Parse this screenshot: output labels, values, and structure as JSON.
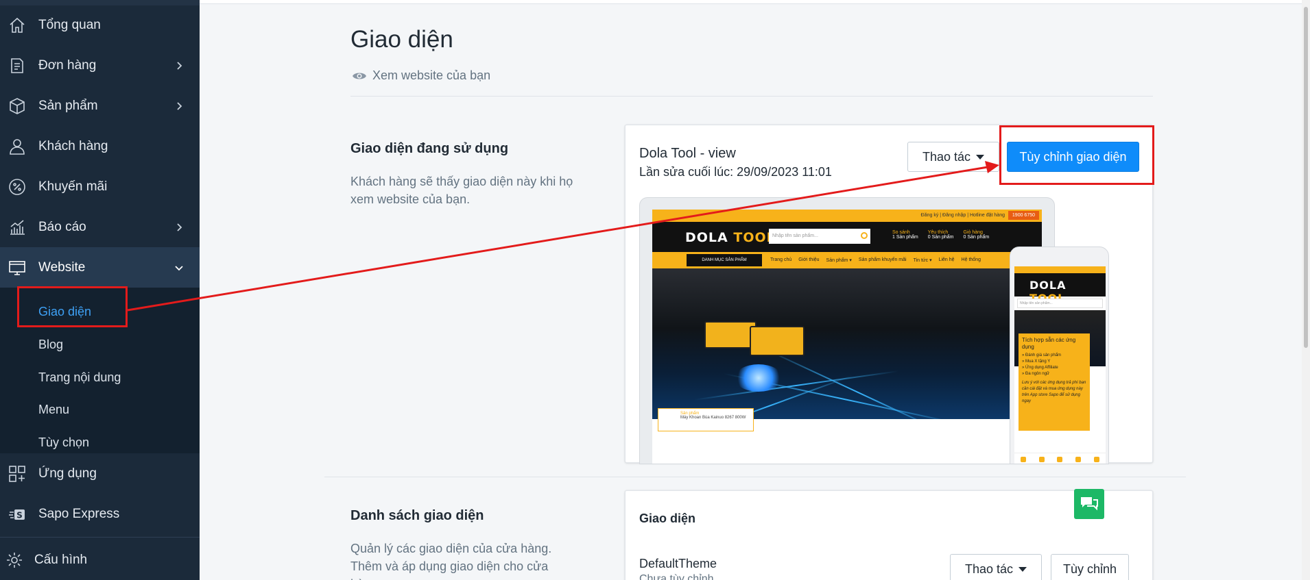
{
  "sidebar": {
    "items": [
      {
        "label": "Tổng quan",
        "icon": "home-icon",
        "chevron": false
      },
      {
        "label": "Đơn hàng",
        "icon": "order-icon",
        "chevron": true
      },
      {
        "label": "Sản phẩm",
        "icon": "box-icon",
        "chevron": true
      },
      {
        "label": "Khách hàng",
        "icon": "user-icon",
        "chevron": false
      },
      {
        "label": "Khuyến mãi",
        "icon": "discount-icon",
        "chevron": false
      },
      {
        "label": "Báo cáo",
        "icon": "report-icon",
        "chevron": true
      },
      {
        "label": "Website",
        "icon": "website-icon",
        "chevron": "down"
      },
      {
        "label": "Ứng dụng",
        "icon": "apps-icon",
        "chevron": false
      },
      {
        "label": "Sapo Express",
        "icon": "sapo-express-icon",
        "chevron": false
      },
      {
        "label": "Cấu hình",
        "icon": "gear-icon",
        "chevron": false
      }
    ],
    "website_sub": [
      "Giao diện",
      "Blog",
      "Trang nội dung",
      "Menu",
      "Tùy chọn"
    ],
    "current_sub": "Giao diện"
  },
  "page": {
    "title": "Giao diện",
    "view_link": "Xem website của bạn"
  },
  "current_theme_section": {
    "title": "Giao diện đang sử dụng",
    "description": "Khách hàng sẽ thấy giao diện này khi họ xem website của bạn."
  },
  "current_theme": {
    "name": "Dola Tool - view",
    "last_edited": "Lần sửa cuối lúc: 29/09/2023 11:01",
    "action_button": "Thao tác",
    "customize_button": "Tùy chỉnh giao diện"
  },
  "preview_site": {
    "topbar_links": "Đăng ký | Đăng nhập | Hotline đặt hàng",
    "hotline": "1900 6750",
    "logo_a": "DOLA ",
    "logo_b": "TOOL",
    "search_placeholder": "Nhập tên sản phẩm...",
    "icons": [
      "So sánh",
      "Yêu thích",
      "Giỏ hàng"
    ],
    "icons_sub": [
      "1 Sản phẩm",
      "0 Sản phẩm",
      "0 Sản phẩm"
    ],
    "category_btn": "DANH MỤC SẢN PHẨM",
    "nav_links": [
      "Trang chủ",
      "Giới thiệu",
      "Sản phẩm ▾",
      "Sản phẩm khuyến mãi",
      "Tin tức ▾",
      "Liên hệ",
      "Hệ thống"
    ],
    "popup_title": "Sản phẩm",
    "popup_text": "Máy Khoan Búa Kainuo 8267 800W",
    "phone_popup_title": "Tích hợp sẵn các ứng dụng",
    "phone_popup_items": [
      "Đánh giá sản phẩm",
      "Mua X tặng Y",
      "Ứng dụng Affiliate",
      "Đa ngôn ngữ"
    ],
    "phone_popup_note": "Lưu ý với các ứng dụng trả phí bạn cần cài đặt và mua ứng dụng này trên App store Sapo để sử dụng ngay"
  },
  "theme_list_section": {
    "title": "Danh sách giao diện",
    "description": "Quản lý các giao diện của cửa hàng. Thêm và áp dụng giao diện cho cửa hàng"
  },
  "theme_list_card": {
    "header": "Giao diện",
    "rows": [
      {
        "name": "DefaultTheme",
        "sub": "Chưa tùy chỉnh",
        "action_button": "Thao tác",
        "customize_button": "Tùy chỉnh"
      }
    ]
  },
  "colors": {
    "sidebar_bg": "#1b2a3a",
    "accent": "#0f8cfa",
    "annotation": "#e31b1b",
    "brand_yellow": "#f7b21a"
  }
}
